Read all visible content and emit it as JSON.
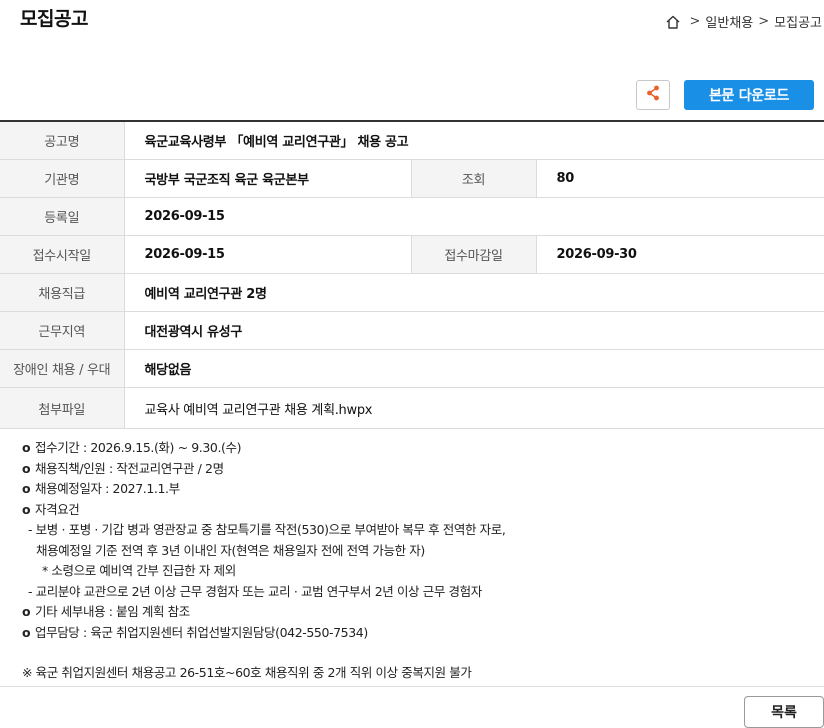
{
  "page": {
    "title": "모집공고"
  },
  "breadcrumb": {
    "items": [
      "일반채용",
      "모집공고"
    ],
    "separator": ">"
  },
  "toolbar": {
    "download_label": "본문 다운로드"
  },
  "info": {
    "title_label": "공고명",
    "title_value": "육군교육사령부 「예비역 교리연구관」 채용 공고",
    "org_label": "기관명",
    "org_value": "국방부 국군조직 육군 육군본부",
    "views_label": "조회",
    "views_value": "80",
    "reg_label": "등록일",
    "reg_value": "2026-09-15",
    "start_label": "접수시작일",
    "start_value": "2026-09-15",
    "end_label": "접수마감일",
    "end_value": "2026-09-30",
    "position_label": "채용직급",
    "position_value": "예비역 교리연구관 2명",
    "region_label": "근무지역",
    "region_value": "대전광역시 유성구",
    "disabled_label": "장애인 채용 / 우대",
    "disabled_value": "해당없음",
    "attach_label": "첨부파일",
    "attach_value": "교육사 예비역 교리연구관 채용 계획.hwpx"
  },
  "content": {
    "l1": "접수기간 : 2026.9.15.(화) ~ 9.30.(수)",
    "l2": "채용직책/인원 : 작전교리연구관 / 2명",
    "l3": "채용예정일자 : 2027.1.1.부",
    "l4": "자격요건",
    "l5": "- 보병 · 포병 · 기갑 병과 영관장교 중 참모특기를 작전(530)으로 부여받아 복무 후 전역한 자로,",
    "l6": "채용예정일 기준 전역 후 3년 이내인 자(현역은 채용일자 전에 전역 가능한 자)",
    "l7": "* 소령으로 예비역 간부 진급한 자 제외",
    "l8": "- 교리분야 교관으로 2년 이상 근무 경험자 또는 교리 · 교범 연구부서 2년 이상 근무 경험자",
    "l9": "기타 세부내용 : 붙임 계획 참조",
    "l10": "업무담당 : 육군 취업지원센터 취업선발지원담당(042-550-7534)",
    "note": "※ 육군 취업지원센터 채용공고 26-51호~60호 채용직위 중 2개 직위 이상 중복지원 불가"
  },
  "footer": {
    "list_label": "목록"
  }
}
